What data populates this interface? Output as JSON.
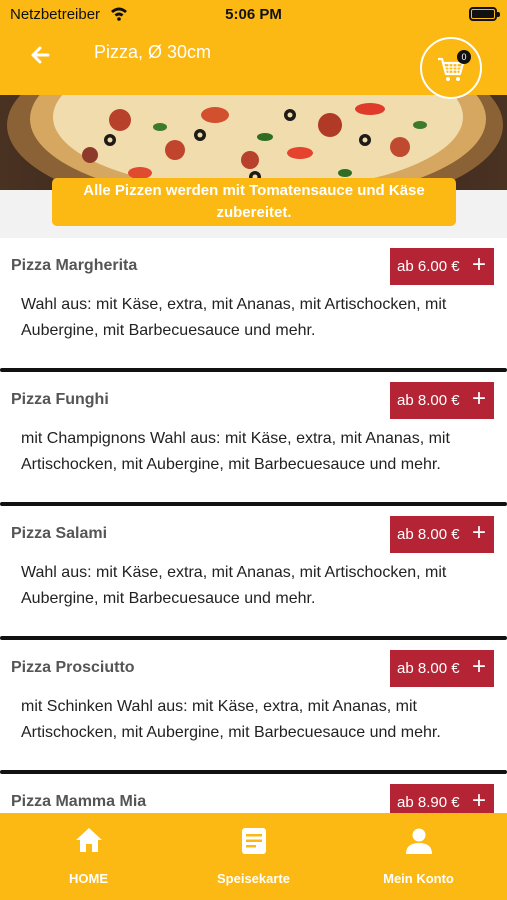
{
  "status_bar": {
    "carrier": "Netzbetreiber",
    "time": "5:06 PM"
  },
  "header": {
    "title": "Pizza, Ø 30cm",
    "cart_count": "0"
  },
  "notice": "Alle Pizzen werden mit Tomatensauce und Käse zubereitet.",
  "items": [
    {
      "name": "Pizza Margherita",
      "price": "ab 6.00 €",
      "description": "Wahl aus: mit Käse, extra, mit Ananas, mit Artischocken, mit Aubergine, mit Barbecuesauce und mehr."
    },
    {
      "name": "Pizza Funghi",
      "price": "ab 8.00 €",
      "description": "mit Champignons Wahl aus: mit Käse, extra, mit Ananas, mit Artischocken, mit Aubergine, mit Barbecuesauce und mehr."
    },
    {
      "name": "Pizza Salami",
      "price": "ab 8.00 €",
      "description": "Wahl aus: mit Käse, extra, mit Ananas, mit Artischocken, mit Aubergine, mit Barbecuesauce und mehr."
    },
    {
      "name": "Pizza Prosciutto",
      "price": "ab 8.00 €",
      "description": "mit Schinken Wahl aus: mit Käse, extra, mit Ananas, mit Artischocken, mit Aubergine, mit Barbecuesauce und mehr."
    },
    {
      "name": "Pizza Mamma Mia",
      "price": "ab 8.90 €",
      "description": ""
    }
  ],
  "add_symbol": "+",
  "nav": {
    "home": "HOME",
    "menu": "Speisekarte",
    "account": "Mein Konto"
  },
  "colors": {
    "primary": "#fcb813",
    "price": "#b52434"
  },
  "icons": {
    "back": "arrow-left-icon",
    "cart": "cart-icon",
    "home": "home-icon",
    "menu": "menu-card-icon",
    "account": "user-icon"
  }
}
